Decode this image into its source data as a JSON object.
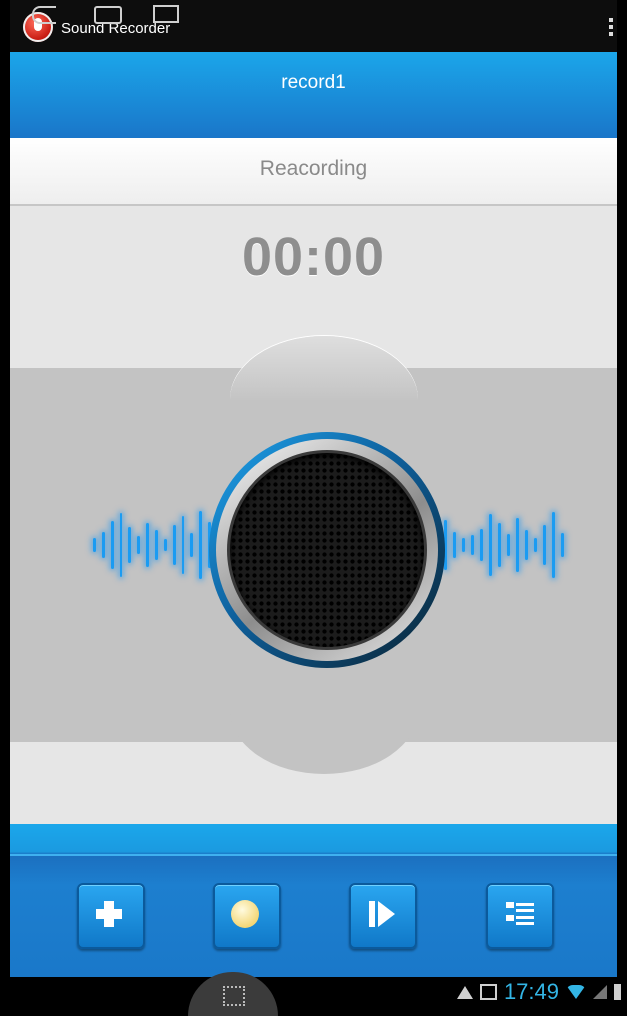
{
  "app": {
    "title": "Sound Recorder",
    "icon": "microphone-icon"
  },
  "header": {
    "filename": "record1"
  },
  "recorder": {
    "status_label": "Reacording",
    "elapsed": "00:00"
  },
  "toolbar": {
    "buttons": [
      {
        "name": "new-recording-button",
        "icon": "plus-icon"
      },
      {
        "name": "record-button",
        "icon": "record-icon"
      },
      {
        "name": "play-button",
        "icon": "play-icon"
      },
      {
        "name": "recordings-list-button",
        "icon": "list-icon"
      }
    ]
  },
  "system": {
    "time": "17:49"
  },
  "colors": {
    "header_blue": "#1a8fdc",
    "accent": "#33b5e5",
    "wave": "#1b9cf2",
    "record_dot": "#f3d777"
  }
}
